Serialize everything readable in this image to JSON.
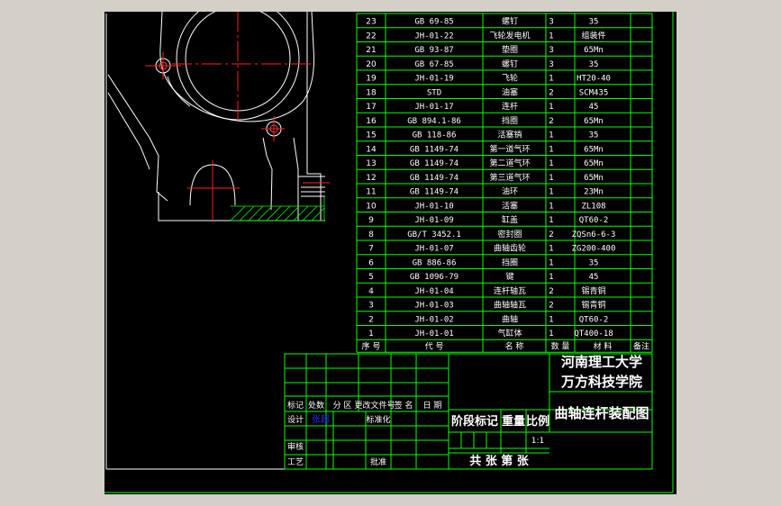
{
  "parts": [
    {
      "no": "23",
      "code": "GB 69-85",
      "name": "螺钉",
      "qty": "3",
      "mat": "35"
    },
    {
      "no": "22",
      "code": "JH-01-22",
      "name": "飞轮发电机",
      "qty": "1",
      "mat": "组装件"
    },
    {
      "no": "21",
      "code": "GB 93-87",
      "name": "垫圈",
      "qty": "3",
      "mat": "65Mn"
    },
    {
      "no": "20",
      "code": "GB 67-85",
      "name": "螺钉",
      "qty": "3",
      "mat": "35"
    },
    {
      "no": "19",
      "code": "JH-01-19",
      "name": "飞轮",
      "qty": "1",
      "mat": "HT20-40"
    },
    {
      "no": "18",
      "code": "STD",
      "name": "油塞",
      "qty": "2",
      "mat": "SCM435"
    },
    {
      "no": "17",
      "code": "JH-01-17",
      "name": "连杆",
      "qty": "1",
      "mat": "45"
    },
    {
      "no": "16",
      "code": "GB 894.1-86",
      "name": "挡圈",
      "qty": "2",
      "mat": "65Mn"
    },
    {
      "no": "15",
      "code": "GB 118-86",
      "name": "活塞销",
      "qty": "1",
      "mat": "35"
    },
    {
      "no": "14",
      "code": "GB 1149-74",
      "name": "第一道气环",
      "qty": "1",
      "mat": "65Mn"
    },
    {
      "no": "13",
      "code": "GB 1149-74",
      "name": "第二道气环",
      "qty": "1",
      "mat": "65Mn"
    },
    {
      "no": "12",
      "code": "GB 1149-74",
      "name": "第三道气环",
      "qty": "1",
      "mat": "65Mn"
    },
    {
      "no": "11",
      "code": "GB 1149-74",
      "name": "油环",
      "qty": "1",
      "mat": "23Mn"
    },
    {
      "no": "10",
      "code": "JH-01-10",
      "name": "活塞",
      "qty": "1",
      "mat": "ZL108"
    },
    {
      "no": "9",
      "code": "JH-01-09",
      "name": "缸盖",
      "qty": "1",
      "mat": "QT60-2"
    },
    {
      "no": "8",
      "code": "GB/T 3452.1",
      "name": "密封圈",
      "qty": "2",
      "mat": "ZQSn6-6-3"
    },
    {
      "no": "7",
      "code": "JH-01-07",
      "name": "曲轴齿轮",
      "qty": "1",
      "mat": "ZG200-400"
    },
    {
      "no": "6",
      "code": "GB 886-86",
      "name": "挡圈",
      "qty": "1",
      "mat": "35"
    },
    {
      "no": "5",
      "code": "GB 1096-79",
      "name": "键",
      "qty": "1",
      "mat": "45"
    },
    {
      "no": "4",
      "code": "JH-01-04",
      "name": "连杆轴瓦",
      "qty": "2",
      "mat": "锡青铜"
    },
    {
      "no": "3",
      "code": "JH-01-03",
      "name": "曲轴轴瓦",
      "qty": "2",
      "mat": "锡青铜"
    },
    {
      "no": "2",
      "code": "JH-01-02",
      "name": "曲轴",
      "qty": "1",
      "mat": "QT60-2"
    },
    {
      "no": "1",
      "code": "JH-01-01",
      "name": "气缸体",
      "qty": "1",
      "mat": "QT400-18"
    }
  ],
  "headers": {
    "no": "序 号",
    "code": "代 号",
    "name": "名 称",
    "qty": "数 量",
    "mat": "材 料",
    "note": "备注"
  },
  "title_block": {
    "school_line1": "河南理工大学",
    "school_line2": "万方科技学院",
    "drawing_title": "曲轴连杆装配图",
    "stage_mark": "阶段标记",
    "weight": "重量",
    "ratio": "比例",
    "scale": "1:1",
    "sheets": "共  张  第  张",
    "rev_labels": [
      "标记",
      "处数",
      "分 区",
      "更改文件号",
      "签 名",
      "日 期"
    ],
    "design": "设计",
    "designer": "张超",
    "standardize": "标准化",
    "review": "审核",
    "process": "工艺",
    "approve": "批准"
  },
  "colors": {
    "frame": "#00ff00",
    "text": "#ffffff",
    "center": "#ff0000",
    "hatch": "#00ff00",
    "designer": "#0000ff"
  }
}
